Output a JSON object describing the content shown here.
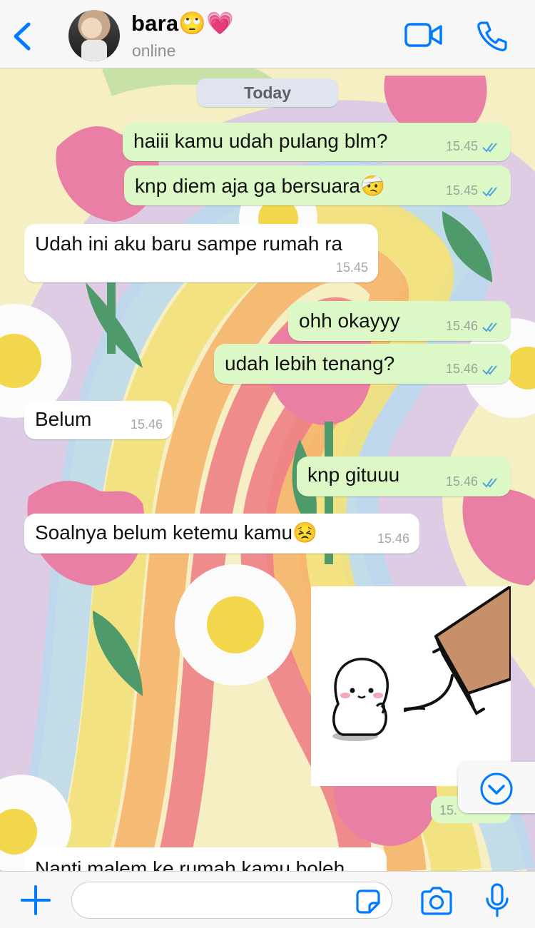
{
  "header": {
    "back_icon": "chevron-left-icon",
    "contact_name": "bara🙄💗",
    "status": "online",
    "video_icon": "video-camera-icon",
    "call_icon": "phone-icon"
  },
  "chat": {
    "date_label": "Today",
    "messages": [
      {
        "direction": "outgoing",
        "text": "haiii kamu udah pulang blm?",
        "time": "15.45",
        "read": true
      },
      {
        "direction": "outgoing",
        "text": "knp diem aja ga bersuara🤕",
        "time": "15.45",
        "read": true
      },
      {
        "direction": "incoming",
        "text": "Udah ini aku baru sampe rumah ra",
        "time": "15.45"
      },
      {
        "direction": "outgoing",
        "text": "ohh okayyy",
        "time": "15.46",
        "read": true
      },
      {
        "direction": "outgoing",
        "text": "udah lebih tenang?",
        "time": "15.46",
        "read": true
      },
      {
        "direction": "incoming",
        "text": "Belum",
        "time": "15.46"
      },
      {
        "direction": "outgoing",
        "text": "knp gituuu",
        "time": "15.46",
        "read": true
      },
      {
        "direction": "incoming",
        "text": "Soalnya belum ketemu kamu😣",
        "time": "15.46"
      }
    ],
    "sticker_caption_time": "15.",
    "partial_incoming_text": "Nanti malem ke rumah kamu boleh",
    "scroll_down_icon": "chevron-down-circle-icon"
  },
  "input_bar": {
    "plus_icon": "plus-icon",
    "placeholder": "",
    "sticker_icon": "sticker-icon",
    "camera_icon": "camera-icon",
    "mic_icon": "microphone-icon"
  },
  "colors": {
    "accent": "#007aff",
    "outgoing_bubble": "#dcf8c6",
    "incoming_bubble": "#ffffff",
    "read_ticks": "#4fa3e0"
  }
}
